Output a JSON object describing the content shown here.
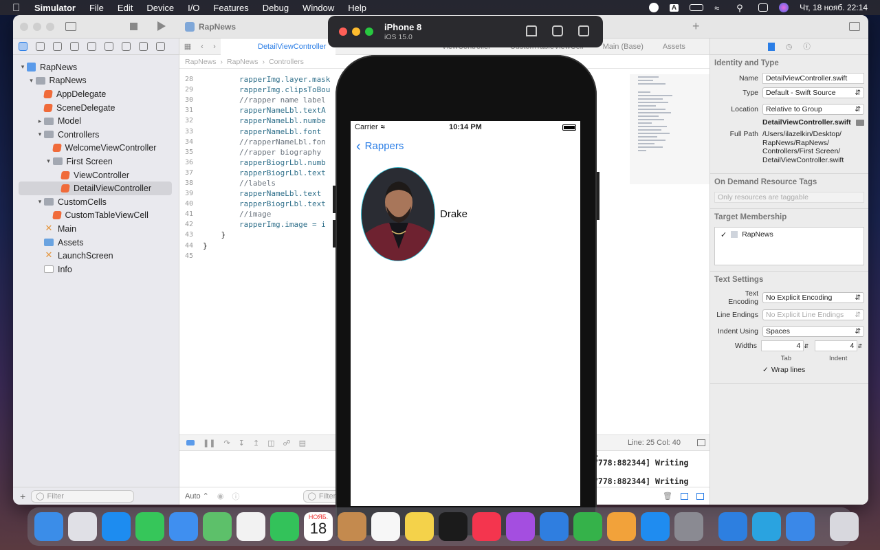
{
  "menubar": {
    "app": "Simulator",
    "items": [
      "File",
      "Edit",
      "Device",
      "I/O",
      "Features",
      "Debug",
      "Window",
      "Help"
    ],
    "clock": "Чт, 18 нояб.  22:14",
    "input_letter": "A"
  },
  "xcode": {
    "project_title": "RapNews",
    "editor_tab": "DetailViewController",
    "bg_tabs": [
      "ViewController",
      "CustomTableViewCell",
      "Main (Base)",
      "Assets"
    ],
    "breadcrumb": [
      "RapNews",
      "RapNews",
      "Controllers"
    ],
    "tree": [
      {
        "label": "RapNews",
        "icon": "proj",
        "indent": 0,
        "disc": "▾"
      },
      {
        "label": "RapNews",
        "icon": "folder",
        "indent": 1,
        "disc": "▾"
      },
      {
        "label": "AppDelegate",
        "icon": "swift",
        "indent": 2,
        "disc": ""
      },
      {
        "label": "SceneDelegate",
        "icon": "swift",
        "indent": 2,
        "disc": ""
      },
      {
        "label": "Model",
        "icon": "folder",
        "indent": 2,
        "disc": "▸"
      },
      {
        "label": "Controllers",
        "icon": "folder",
        "indent": 2,
        "disc": "▾"
      },
      {
        "label": "WelcomeViewController",
        "icon": "swift",
        "indent": 3,
        "disc": ""
      },
      {
        "label": "First Screen",
        "icon": "folder",
        "indent": 3,
        "disc": "▾"
      },
      {
        "label": "ViewController",
        "icon": "swift",
        "indent": 4,
        "disc": ""
      },
      {
        "label": "DetailViewController",
        "icon": "swift",
        "indent": 4,
        "disc": "",
        "selected": true
      },
      {
        "label": "CustomCells",
        "icon": "folder",
        "indent": 2,
        "disc": "▾"
      },
      {
        "label": "CustomTableViewCell",
        "icon": "swift",
        "indent": 3,
        "disc": ""
      },
      {
        "label": "Main",
        "icon": "sb",
        "indent": 2,
        "disc": ""
      },
      {
        "label": "Assets",
        "icon": "assets",
        "indent": 2,
        "disc": ""
      },
      {
        "label": "LaunchScreen",
        "icon": "sb",
        "indent": 2,
        "disc": ""
      },
      {
        "label": "Info",
        "icon": "plist",
        "indent": 2,
        "disc": ""
      }
    ],
    "nav_filter": "Filter",
    "code_lines": [
      {
        "n": "28",
        "code": "        rapperImg.layer.mask"
      },
      {
        "n": "29",
        "code": "        rapperImg.clipsToBou"
      },
      {
        "n": "30",
        "code": "        //rapper name label"
      },
      {
        "n": "31",
        "code": "        rapperNameLbl.textA"
      },
      {
        "n": "32",
        "code": "        rapperNameLbl.numbe"
      },
      {
        "n": "33",
        "code": "        rapperNameLbl.font "
      },
      {
        "n": "34",
        "code": "        //rapperNameLbl.fon"
      },
      {
        "n": "35",
        "code": "        //rapper biography "
      },
      {
        "n": "36",
        "code": "        rapperBiogrLbl.numb"
      },
      {
        "n": "37",
        "code": "        rapperBiogrLbl.text"
      },
      {
        "n": "38",
        "code": "        //labels"
      },
      {
        "n": "39",
        "code": "        rapperNameLbl.text "
      },
      {
        "n": "40",
        "code": "        rapperBiogrLbl.text"
      },
      {
        "n": "41",
        "code": "        //image"
      },
      {
        "n": "42",
        "code": "        rapperImg.image = i"
      },
      {
        "n": "43",
        "code": "    }"
      },
      {
        "n": "44",
        "code": "}"
      },
      {
        "n": "45",
        "code": ""
      }
    ],
    "cursor_pos": "Line: 25  Col: 40",
    "console": [
      ">",
      "7778:882344] Writing",
      "7778:882344] Writing"
    ],
    "console_auto": "Auto ⌃",
    "console_filter": "Filter"
  },
  "inspector": {
    "identity_title": "Identity and Type",
    "name_label": "Name",
    "name_value": "DetailViewController.swift",
    "type_label": "Type",
    "type_value": "Default - Swift Source",
    "location_label": "Location",
    "location_value": "Relative to Group",
    "location_file": "DetailViewController.swift",
    "fullpath_label": "Full Path",
    "fullpath_value": "/Users/ilazelkin/Desktop/ RapNews/RapNews/ Controllers/First Screen/ DetailViewController.swift",
    "odr_title": "On Demand Resource Tags",
    "odr_placeholder": "Only resources are taggable",
    "target_title": "Target Membership",
    "target_name": "RapNews",
    "text_title": "Text Settings",
    "encoding_label": "Text Encoding",
    "encoding_value": "No Explicit Encoding",
    "endings_label": "Line Endings",
    "endings_value": "No Explicit Line Endings",
    "indent_label": "Indent Using",
    "indent_value": "Spaces",
    "widths_label": "Widths",
    "tab_value": "4",
    "indent_width_value": "4",
    "tab_caption": "Tab",
    "indent_caption": "Indent",
    "wrap_label": "Wrap lines"
  },
  "simulator": {
    "device": "iPhone 8",
    "os": "iOS 15.0",
    "carrier": "Carrier",
    "time": "10:14 PM",
    "back_label": "Rappers",
    "rapper_name": "Drake"
  },
  "dock": {
    "calendar_month": "НОЯБ.",
    "calendar_day": "18",
    "apps": [
      {
        "name": "finder",
        "color": "#3b8de8"
      },
      {
        "name": "launchpad",
        "color": "#e0e0e6"
      },
      {
        "name": "safari",
        "color": "#1d8cf0"
      },
      {
        "name": "messages",
        "color": "#36c65a"
      },
      {
        "name": "mail",
        "color": "#3f8ff0"
      },
      {
        "name": "maps",
        "color": "#5dc06a"
      },
      {
        "name": "photos",
        "color": "#f2f2f2"
      },
      {
        "name": "facetime",
        "color": "#33c25a"
      },
      {
        "name": "calendar",
        "color": "#ffffff"
      },
      {
        "name": "contacts",
        "color": "#c48a4e"
      },
      {
        "name": "reminders",
        "color": "#f7f7f7"
      },
      {
        "name": "notes",
        "color": "#f4d24a"
      },
      {
        "name": "apple-tv",
        "color": "#1b1b1b"
      },
      {
        "name": "music",
        "color": "#f4354e"
      },
      {
        "name": "podcasts",
        "color": "#a44ee0"
      },
      {
        "name": "keynote",
        "color": "#2f7ee0"
      },
      {
        "name": "numbers",
        "color": "#35b24a"
      },
      {
        "name": "pages",
        "color": "#f2a23a"
      },
      {
        "name": "app-store",
        "color": "#1f8cf0"
      },
      {
        "name": "system-preferences",
        "color": "#8a8a92"
      }
    ],
    "apps_right": [
      {
        "name": "xcode",
        "color": "#2d7fe0"
      },
      {
        "name": "telegram",
        "color": "#2aa3e0"
      },
      {
        "name": "simulator",
        "color": "#3a88e8"
      },
      {
        "name": "trash",
        "color": "#d8d8de"
      }
    ]
  }
}
